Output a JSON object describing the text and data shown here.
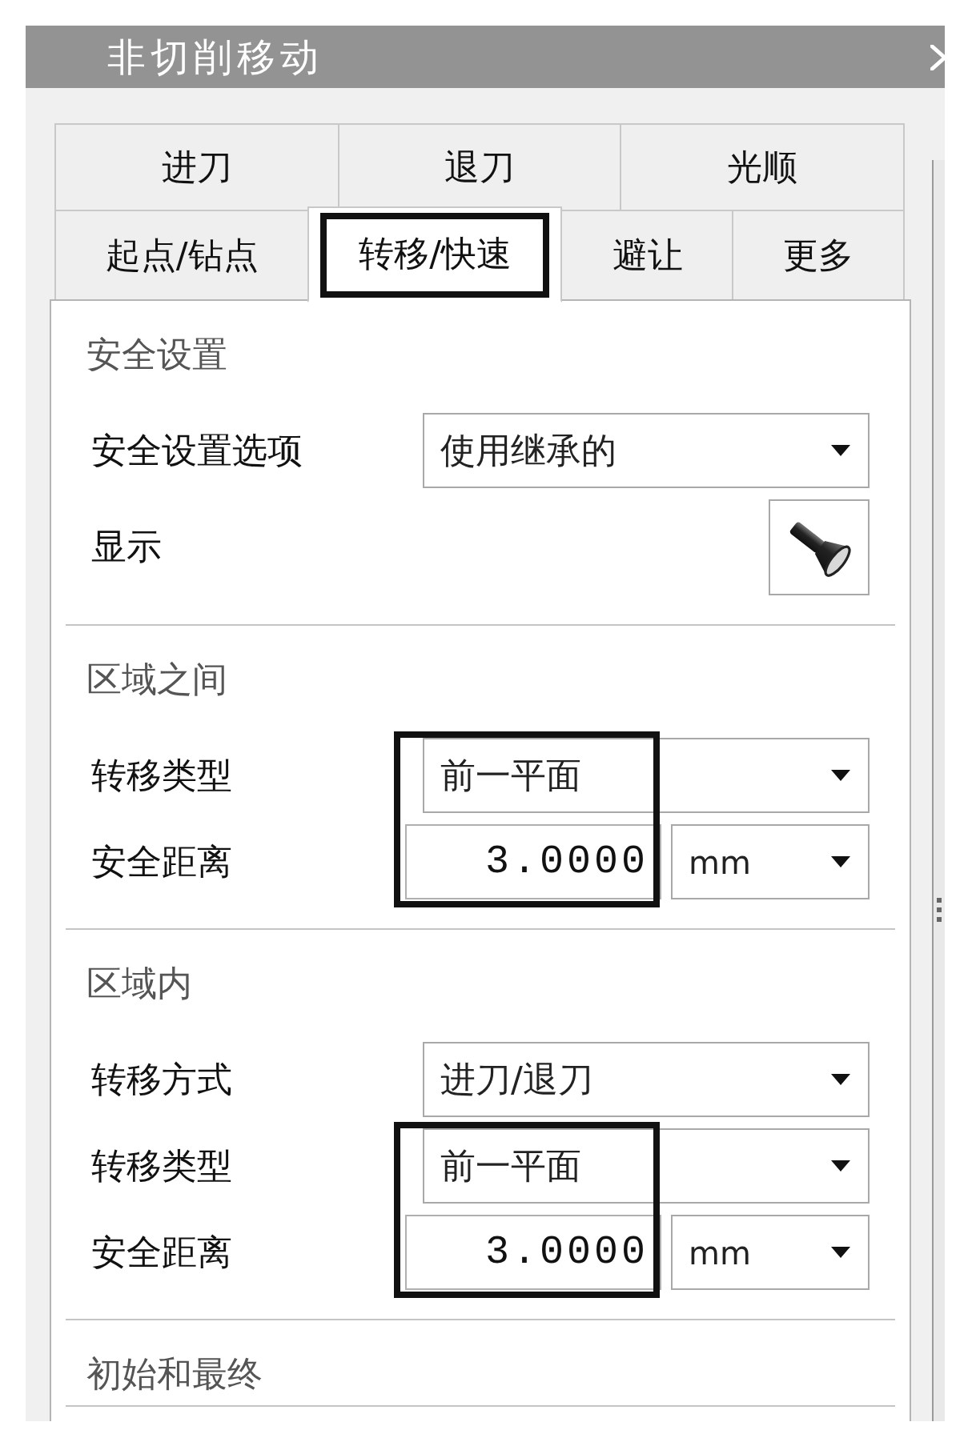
{
  "window": {
    "title": "非切削移动"
  },
  "tab_rows": [
    {
      "tabs": [
        {
          "label": "进刀",
          "selected": false,
          "highlighted": false
        },
        {
          "label": "退刀",
          "selected": false,
          "highlighted": false
        },
        {
          "label": "光顺",
          "selected": false,
          "highlighted": false
        }
      ]
    },
    {
      "tabs": [
        {
          "label": "起点/钻点",
          "selected": false,
          "highlighted": false
        },
        {
          "label": "转移/快速",
          "selected": true,
          "highlighted": true
        },
        {
          "label": "避让",
          "selected": false,
          "highlighted": false
        },
        {
          "label": "更多",
          "selected": false,
          "highlighted": false
        }
      ]
    }
  ],
  "sections": [
    {
      "title": "安全设置",
      "rows": [
        {
          "kind": "dropdown",
          "label": "安全设置选项",
          "value": "使用继承的",
          "highlighted": false
        },
        {
          "kind": "button",
          "label": "显示",
          "highlighted": false
        }
      ]
    },
    {
      "title": "区域之间",
      "rows": [
        {
          "kind": "dropdown",
          "label": "转移类型",
          "value": "前一平面",
          "highlighted": true
        },
        {
          "kind": "number",
          "label": "安全距离",
          "value": "3.0000",
          "unit": "mm",
          "highlighted": true
        }
      ]
    },
    {
      "title": "区域内",
      "rows": [
        {
          "kind": "dropdown",
          "label": "转移方式",
          "value": "进刀/退刀",
          "highlighted": false
        },
        {
          "kind": "dropdown",
          "label": "转移类型",
          "value": "前一平面",
          "highlighted": true
        },
        {
          "kind": "number",
          "label": "安全距离",
          "value": "3.0000",
          "unit": "mm",
          "highlighted": true
        }
      ]
    },
    {
      "title": "初始和最终"
    }
  ]
}
